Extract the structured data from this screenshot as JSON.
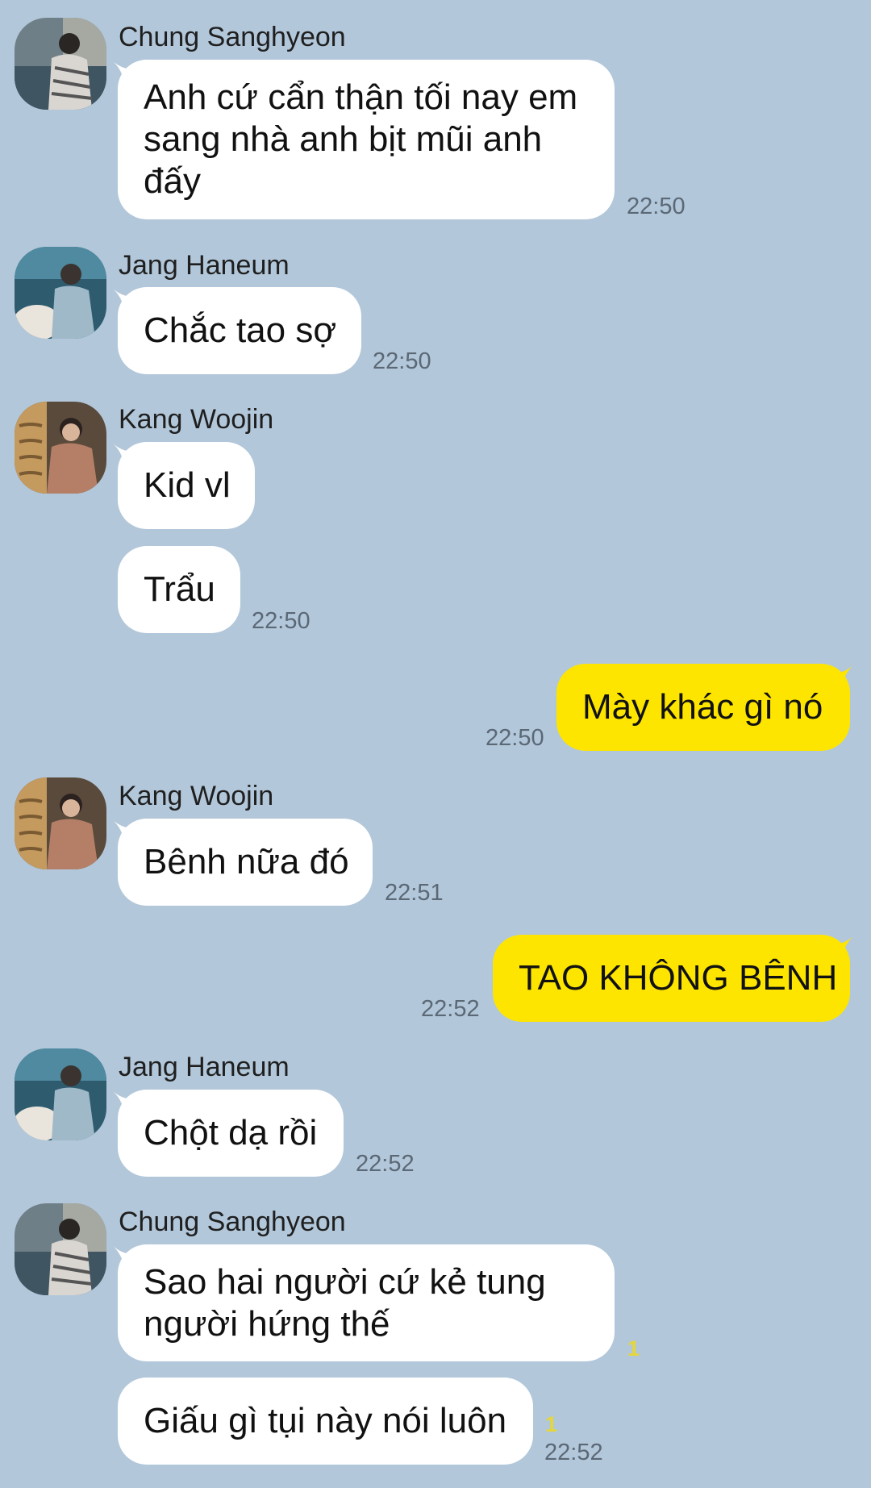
{
  "colors": {
    "background": "#b2c7da",
    "incoming_bubble": "#ffffff",
    "outgoing_bubble": "#fee500",
    "time_text": "#5b6876",
    "unread_count": "#e6d63a"
  },
  "messages": [
    {
      "sender": "Chung Sanghyeon",
      "avatar": "avatar-chung-sanghyeon",
      "lines": [
        "Anh cứ cẩn thận tối nay em",
        "sang nhà anh bịt mũi anh",
        "đấy"
      ],
      "time": "22:50"
    },
    {
      "sender": "Jang Haneum",
      "avatar": "avatar-jang-haneum",
      "lines": [
        "Chắc tao sợ"
      ],
      "time": "22:50"
    },
    {
      "sender": "Kang Woojin",
      "avatar": "avatar-kang-woojin",
      "lines": [
        "Kid vl"
      ]
    },
    {
      "lines": [
        "Trẩu"
      ],
      "time": "22:50"
    },
    {
      "outgoing": true,
      "lines": [
        "Mày khác gì nó"
      ],
      "time": "22:50"
    },
    {
      "sender": "Kang Woojin",
      "avatar": "avatar-kang-woojin",
      "lines": [
        "Bênh nữa đó"
      ],
      "time": "22:51"
    },
    {
      "outgoing": true,
      "lines": [
        "TAO KHÔNG BÊNH"
      ],
      "time": "22:52"
    },
    {
      "sender": "Jang Haneum",
      "avatar": "avatar-jang-haneum",
      "lines": [
        "Chột dạ rồi"
      ],
      "time": "22:52"
    },
    {
      "sender": "Chung Sanghyeon",
      "avatar": "avatar-chung-sanghyeon",
      "lines": [
        "Sao hai người cứ kẻ tung",
        "người hứng thế"
      ],
      "unread": "1"
    },
    {
      "lines": [
        "Giấu gì tụi này nói luôn"
      ],
      "unread": "1",
      "time": "22:52"
    }
  ]
}
